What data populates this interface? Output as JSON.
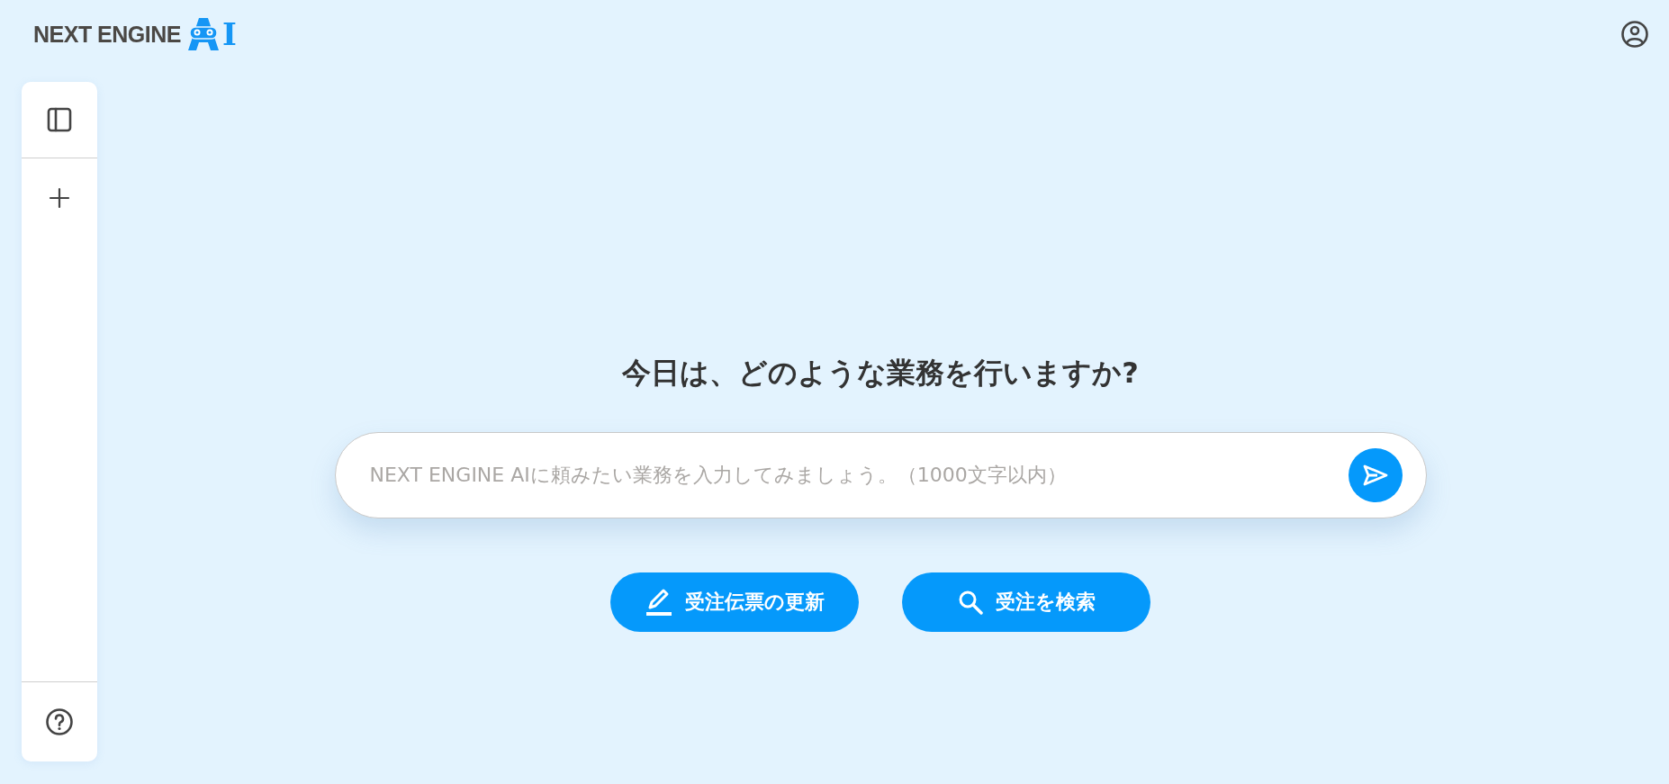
{
  "logo": {
    "text": "NEXT ENGINE",
    "suffix": "I"
  },
  "heading": "今日は、どのような業務を行いますか?",
  "prompt": {
    "placeholder": "NEXT ENGINE AIに頼みたい業務を入力してみましょう。（1000文字以内）"
  },
  "actions": [
    {
      "kind": "edit",
      "label": "受注伝票の更新"
    },
    {
      "kind": "search",
      "label": "受注を検索"
    }
  ]
}
